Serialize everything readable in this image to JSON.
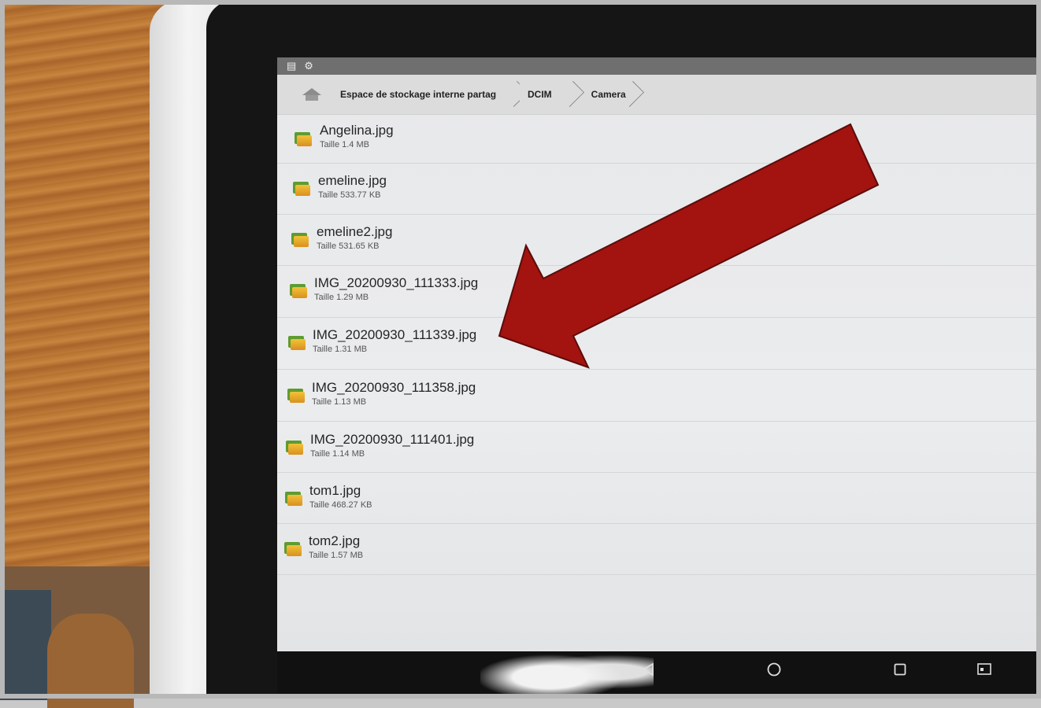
{
  "status_bar": {
    "icons": [
      "storage-icon",
      "settings-icon"
    ]
  },
  "breadcrumb": {
    "home_icon": "home-icon",
    "items": [
      "Espace de stockage interne partag",
      "DCIM",
      "Camera"
    ]
  },
  "files": [
    {
      "name": "Angelina.jpg",
      "size": "Taille 1.4 MB"
    },
    {
      "name": "emeline.jpg",
      "size": "Taille 533.77 KB"
    },
    {
      "name": "emeline2.jpg",
      "size": "Taille 531.65 KB"
    },
    {
      "name": "IMG_20200930_111333.jpg",
      "size": "Taille 1.29 MB"
    },
    {
      "name": "IMG_20200930_111339.jpg",
      "size": "Taille 1.31 MB"
    },
    {
      "name": "IMG_20200930_111358.jpg",
      "size": "Taille 1.13 MB"
    },
    {
      "name": "IMG_20200930_111401.jpg",
      "size": "Taille 1.14 MB"
    },
    {
      "name": "tom1.jpg",
      "size": "Taille 468.27 KB"
    },
    {
      "name": "tom2.jpg",
      "size": "Taille 1.57 MB"
    }
  ],
  "navbar": {
    "icons": [
      "back-icon",
      "home-circle-icon",
      "recents-icon",
      "screenshot-icon"
    ]
  },
  "colors": {
    "arrow": "#a3130f",
    "folder_green": "#5e9c2f",
    "folder_yellow": "#e8ae2e"
  }
}
